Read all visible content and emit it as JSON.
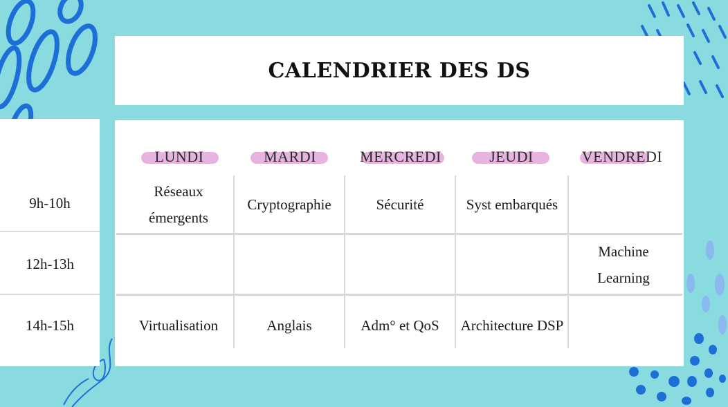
{
  "title": "CALENDRIER DES DS",
  "days": [
    "LUNDI",
    "MARDI",
    "MERCREDI",
    "JEUDI",
    "VENDREDI"
  ],
  "times": [
    "9h-10h",
    "12h-13h",
    "14h-15h"
  ],
  "rows": [
    [
      "Réseaux émergents",
      "Cryptographie",
      "Sécurité",
      "Syst embarqués",
      ""
    ],
    [
      "",
      "",
      "",
      "",
      "Machine Learning"
    ],
    [
      "Virtualisation",
      "Anglais",
      "Adm° et QoS",
      "Architecture DSP",
      ""
    ]
  ],
  "colors": {
    "background": "#8adbe0",
    "highlight": "#e7b4df",
    "decoration_blue": "#1c6fd6",
    "decoration_light_blue": "#8ab8ef"
  }
}
